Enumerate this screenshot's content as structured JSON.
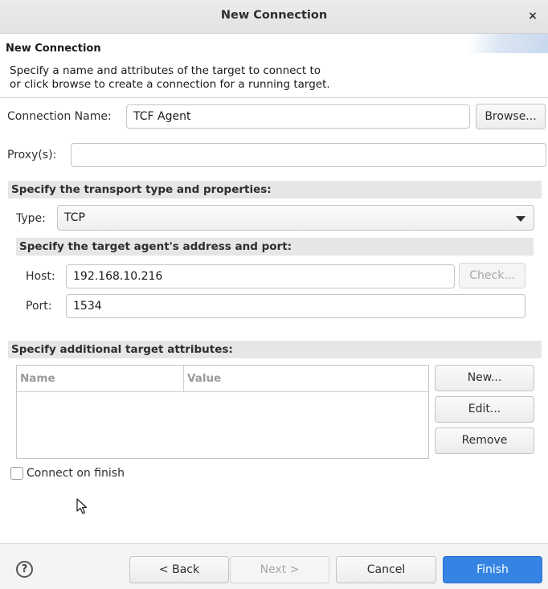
{
  "window": {
    "title": "New Connection",
    "close_glyph": "×"
  },
  "header": {
    "title": "New Connection",
    "description": "Specify a name and attributes of the target to connect to\nor click browse to create a connection for a running target."
  },
  "connection": {
    "label": "Connection Name:",
    "value": "TCF Agent",
    "browse_label": "Browse..."
  },
  "proxy": {
    "label": "Proxy(s):",
    "value": ""
  },
  "transport": {
    "section_title": "Specify the transport type and properties:",
    "type_label": "Type:",
    "type_value": "TCP",
    "address_section_title": "Specify the target agent's address and port:",
    "host_label": "Host:",
    "host_value": "192.168.10.216",
    "check_label": "Check...",
    "port_label": "Port:",
    "port_value": "1534"
  },
  "attributes": {
    "section_title": "Specify additional target attributes:",
    "columns": [
      "Name",
      "Value"
    ],
    "rows": [],
    "new_label": "New...",
    "edit_label": "Edit...",
    "remove_label": "Remove"
  },
  "connect_on_finish": {
    "label": "Connect on finish",
    "checked": false
  },
  "footer": {
    "help_glyph": "?",
    "back_label": "< Back",
    "next_label": "Next >",
    "cancel_label": "Cancel",
    "finish_label": "Finish"
  },
  "colors": {
    "accent": "#3584e4",
    "section_bg": "#e6e6e6"
  }
}
